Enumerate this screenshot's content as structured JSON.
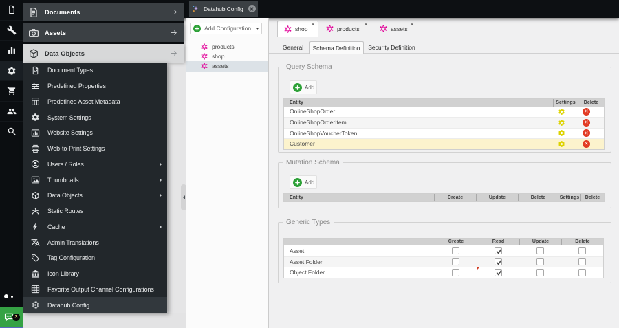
{
  "colors": {
    "accent_green": "#2da137",
    "graphql_pink": "#e10098",
    "selected_row_yellow": "#fcf3cd",
    "gear_yellow": "#ddd300",
    "delete_red": "#e23b24",
    "sidebar_dark": "#22272b",
    "header_dark": "#3b4044"
  },
  "iconbar": {
    "items": [
      {
        "icon": "file-icon"
      },
      {
        "icon": "wrench-icon"
      },
      {
        "icon": "bar-chart-icon"
      },
      {
        "icon": "gear-icon",
        "active": true
      },
      {
        "icon": "cart-icon"
      },
      {
        "icon": "users-icon"
      },
      {
        "icon": "search-icon"
      }
    ],
    "chat": {
      "badge": "3",
      "icon": "chat-bubble-icon"
    }
  },
  "topbar": {
    "tab": {
      "label": "Datahub Config",
      "icon": "datahub-sparkle-icon"
    }
  },
  "nav": {
    "sections": [
      {
        "label": "Documents",
        "icon": "documents-icon",
        "active": false
      },
      {
        "label": "Assets",
        "icon": "camera-icon",
        "active": false
      },
      {
        "label": "Data Objects",
        "icon": "cube-icon",
        "active": true
      }
    ],
    "menu_items": [
      {
        "label": "Document Types",
        "icon": "document-types-icon",
        "submenu": false,
        "selected": false
      },
      {
        "label": "Predefined Properties",
        "icon": "sliders-icon",
        "submenu": false,
        "selected": false
      },
      {
        "label": "Predefined Asset Metadata",
        "icon": "metadata-grid-icon",
        "submenu": false,
        "selected": false
      },
      {
        "label": "System Settings",
        "icon": "gear-icon",
        "submenu": false,
        "selected": false
      },
      {
        "label": "Website Settings",
        "icon": "chart-frame-icon",
        "submenu": false,
        "selected": false
      },
      {
        "label": "Web-to-Print Settings",
        "icon": "printer-icon",
        "submenu": false,
        "selected": false
      },
      {
        "label": "Users / Roles",
        "icon": "user-circle-icon",
        "submenu": true,
        "selected": false
      },
      {
        "label": "Thumbnails",
        "icon": "image-icon",
        "submenu": true,
        "selected": false
      },
      {
        "label": "Data Objects",
        "icon": "cube-icon",
        "submenu": true,
        "selected": false
      },
      {
        "label": "Static Routes",
        "icon": "hub-icon",
        "submenu": false,
        "selected": false
      },
      {
        "label": "Cache",
        "icon": "lightning-icon",
        "submenu": true,
        "selected": false
      },
      {
        "label": "Admin Translations",
        "icon": "translate-icon",
        "submenu": false,
        "selected": false
      },
      {
        "label": "Tag Configuration",
        "icon": "tag-icon",
        "submenu": false,
        "selected": false
      },
      {
        "label": "Icon Library",
        "icon": "bank-icon",
        "submenu": false,
        "selected": false
      },
      {
        "label": "Favorite Output Channel Configurations",
        "icon": "grid-icon",
        "submenu": false,
        "selected": false
      },
      {
        "label": "Datahub Config",
        "icon": "chip-icon",
        "submenu": false,
        "selected": true
      }
    ]
  },
  "config_panel": {
    "add_button": {
      "label": "Add Configuration",
      "icon": "plus-circle-icon"
    },
    "tree": [
      {
        "label": "products",
        "icon": "graphql-icon",
        "selected": false
      },
      {
        "label": "shop",
        "icon": "graphql-icon",
        "selected": false
      },
      {
        "label": "assets",
        "icon": "graphql-icon",
        "selected": true
      }
    ]
  },
  "editor": {
    "tabs": [
      {
        "label": "shop",
        "icon": "graphql-icon",
        "active": true
      },
      {
        "label": "products",
        "icon": "graphql-icon",
        "active": false
      },
      {
        "label": "assets",
        "icon": "graphql-icon",
        "active": false
      }
    ],
    "subtabs": [
      {
        "label": "General",
        "active": false
      },
      {
        "label": "Schema Definition",
        "active": true
      },
      {
        "label": "Security Definition",
        "active": false
      }
    ],
    "query_schema": {
      "legend": "Query Schema",
      "add_label": "Add",
      "columns": [
        "Entity",
        "Settings",
        "Delete"
      ],
      "rows": [
        {
          "entity": "OnlineShopOrder",
          "selected": false
        },
        {
          "entity": "OnlineShopOrderItem",
          "selected": false
        },
        {
          "entity": "OnlineShopVoucherToken",
          "selected": false
        },
        {
          "entity": "Customer",
          "selected": true
        }
      ]
    },
    "mutation_schema": {
      "legend": "Mutation Schema",
      "add_label": "Add",
      "columns": [
        "Entity",
        "Create",
        "Update",
        "Delete",
        "Settings",
        "Delete"
      ],
      "rows": []
    },
    "generic_types": {
      "legend": "Generic Types",
      "columns": [
        "",
        "Create",
        "Read",
        "Update",
        "Delete"
      ],
      "rows": [
        {
          "label": "Asset",
          "create": false,
          "read": true,
          "update": false,
          "delete": false,
          "dirty": false
        },
        {
          "label": "Asset Folder",
          "create": false,
          "read": true,
          "update": false,
          "delete": false,
          "dirty": false
        },
        {
          "label": "Object Folder",
          "create": false,
          "read": true,
          "update": false,
          "delete": false,
          "dirty": true
        }
      ]
    }
  }
}
